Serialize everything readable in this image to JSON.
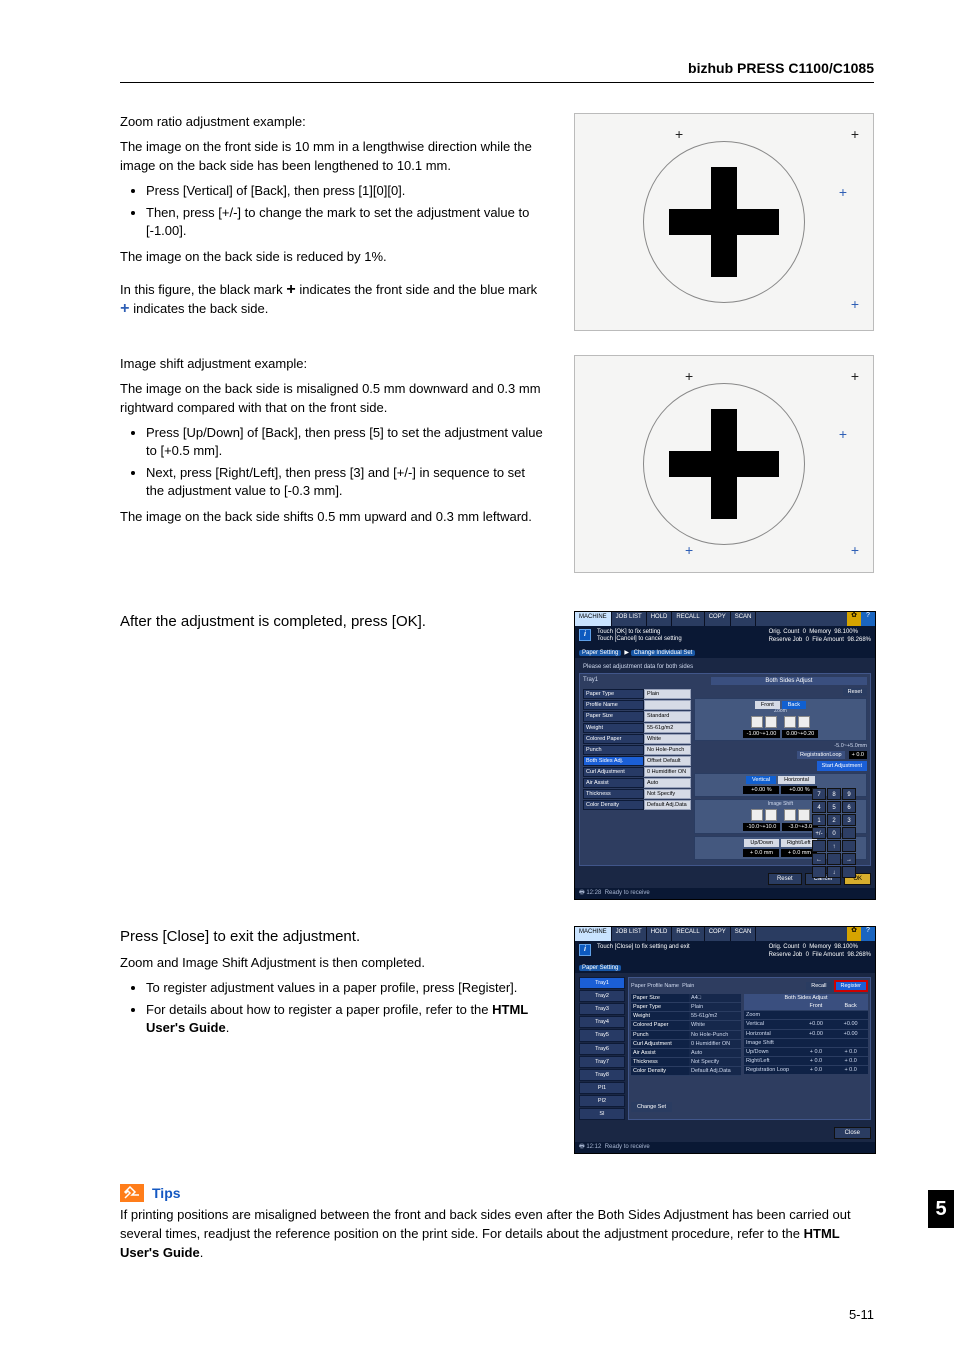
{
  "header": {
    "product": "bizhub PRESS C1100/C1085"
  },
  "section1": {
    "p1": "Zoom ratio adjustment example:",
    "p2": "The image on the front side is 10 mm in a lengthwise direction while the image on the back side has been lengthened to 10.1 mm.",
    "li1": "Press [Vertical] of [Back], then press [1][0][0].",
    "li2": "Then, press [+/-] to change the mark to set the adjustment value to [-1.00].",
    "p3": "The image on the back side is reduced by 1%.",
    "p4a": "In this figure, the black mark ",
    "p4b": " indicates the front side and the blue mark ",
    "p4c": " indicates the back side."
  },
  "section2": {
    "p1": "Image shift adjustment example:",
    "p2": "The image on the back side is misaligned 0.5 mm downward and 0.3 mm rightward compared with that on the front side.",
    "li1": "Press [Up/Down] of [Back], then press [5] to set the adjustment value to [+0.5 mm].",
    "li2": "Next, press [Right/Left], then press [3] and [+/-] in sequence to set the adjustment value to [-0.3 mm].",
    "p3": "The image on the back side shifts 0.5 mm upward and 0.3 mm leftward."
  },
  "section3": {
    "p1": "After the adjustment is completed, press [OK]."
  },
  "section4": {
    "p1": "Press [Close] to exit the adjustment.",
    "p2": "Zoom and Image Shift Adjustment is then completed.",
    "li1": "To register adjustment values in a paper profile, press [Register].",
    "li2a": "For details about how to register a paper profile, refer to the ",
    "li2b": "HTML User's Guide",
    "li2c": "."
  },
  "panel1": {
    "tabs": [
      "MACHINE",
      "JOB LIST",
      "HOLD",
      "RECALL",
      "COPY",
      "SCAN"
    ],
    "info1": "Touch [OK] to fix setting",
    "info2": "Touch [Cancel] to cancel setting",
    "meters": {
      "l1a": "Orig. Count",
      "l1b": "0",
      "l1c": "Memory",
      "l1d": "98.100%",
      "l2a": "Reserve Job",
      "l2b": "0",
      "l2c": "File Amount",
      "l2d": "98.268%"
    },
    "crumb": [
      "Paper Setting",
      "Change Individual Set"
    ],
    "note": "Please set adjustment data for both sides",
    "header_l": "Tray1",
    "header_r": "Both Sides Adjust",
    "left_rows": [
      [
        "Paper Type",
        "Plain"
      ],
      [
        "Profile Name",
        ""
      ],
      [
        "Paper Size",
        "Standard"
      ],
      [
        "Weight",
        "55-61g/m2"
      ],
      [
        "Colored Paper",
        "White"
      ],
      [
        "Punch",
        "No Hole-Punch"
      ],
      [
        "Both Sides Adj.",
        "Offset Default"
      ],
      [
        "Curl Adjustment",
        "0  Humidifier ON"
      ],
      [
        "Air Assist",
        "Auto"
      ],
      [
        "Thickness",
        "Not Specify"
      ],
      [
        "Color Density",
        "Default Adj.Data"
      ]
    ],
    "rbox1": {
      "tabs": [
        "Front",
        "Back"
      ],
      "sub": "Zoom",
      "v1": "-1.00~+1.00",
      "v2": "0.00~+0.20",
      "icons": 4
    },
    "topline": {
      "txt": "-5.0~+5.0mm",
      "lbl": "RegistrationLoop",
      "val": "+ 0.0",
      "reset": "Reset"
    },
    "start": "Start Adjustment",
    "rbox2": {
      "tabs": [
        "Vertical",
        "Horizontal"
      ],
      "v1": "+0.00 %",
      "v2": "+0.00 %"
    },
    "rbox3": {
      "sub": "Image Shift",
      "icons": 4,
      "v1": "-10.0~+10.0",
      "v2": "-3.0~+3.0"
    },
    "rbox4": {
      "tabs": [
        "Up/Down",
        "Right/Left"
      ],
      "v1": "+ 0.0 mm",
      "v2": "+ 0.0 mm"
    },
    "keypad": [
      "7",
      "8",
      "9",
      "4",
      "5",
      "6",
      "1",
      "2",
      "3",
      "+/-",
      "0",
      "",
      "",
      "↑",
      "",
      "←",
      "",
      "→",
      "",
      "↓",
      ""
    ],
    "footer": [
      "Reset",
      "Cancel",
      "OK"
    ],
    "status_time": "12:28",
    "status_text": "Ready to receive"
  },
  "panel2": {
    "tabs": [
      "MACHINE",
      "JOB LIST",
      "HOLD",
      "RECALL",
      "COPY",
      "SCAN"
    ],
    "info1": "Touch [Close] to fix setting and exit",
    "meters": {
      "l1a": "Orig. Count",
      "l1b": "0",
      "l1c": "Memory",
      "l1d": "98.100%",
      "l2a": "Reserve Job",
      "l2b": "0",
      "l2c": "File Amount",
      "l2d": "98.268%"
    },
    "crumb": "Paper Setting",
    "sidebar": [
      "Tray1",
      "Tray2",
      "Tray3",
      "Tray4",
      "Tray5",
      "Tray6",
      "Tray7",
      "Tray8",
      "PI1",
      "PI2",
      "SI"
    ],
    "main_title_l": "Paper Profile Name",
    "main_title_v": "Plain",
    "recall": "Recall",
    "register": "Register",
    "rows": [
      [
        "Paper Size",
        "A4□"
      ],
      [
        "Paper Type",
        "Plain"
      ],
      [
        "Weight",
        "55-61g/m2"
      ],
      [
        "Colored Paper",
        "White"
      ],
      [
        "Punch",
        "No Hole-Punch"
      ],
      [
        "Curl Adjustment",
        "0  Humidifier ON"
      ],
      [
        "Air Assist",
        "Auto"
      ],
      [
        "Thickness",
        "Not Specify"
      ],
      [
        "Color Density",
        "Default Adj.Data"
      ]
    ],
    "table": {
      "title": "Both Sides Adjust",
      "cols": [
        "",
        "Front",
        "Back"
      ],
      "rows": [
        [
          "Zoom",
          "",
          ""
        ],
        [
          "Vertical",
          "+0.00",
          "+0.00"
        ],
        [
          "Horizontal",
          "+0.00",
          "+0.00"
        ],
        [
          "Image Shift",
          "",
          ""
        ],
        [
          "Up/Down",
          "+ 0.0",
          "+ 0.0"
        ],
        [
          "Right/Left",
          "+ 0.0",
          "+ 0.0"
        ],
        [
          "Registration Loop",
          "+ 0.0",
          "+ 0.0"
        ]
      ]
    },
    "change": "Change Set",
    "close": "Close",
    "status_time": "12:12",
    "status_text": "Ready to receive"
  },
  "tips": {
    "label": "Tips",
    "text_a": "If printing positions are misaligned between the front and back sides even after the Both Sides Adjustment has been carried out several times, readjust the reference position on the print side. For details about the adjustment procedure, refer to the ",
    "text_b": "HTML User's Guide",
    "text_c": "."
  },
  "chapter": "5",
  "pagenum": "5-11"
}
